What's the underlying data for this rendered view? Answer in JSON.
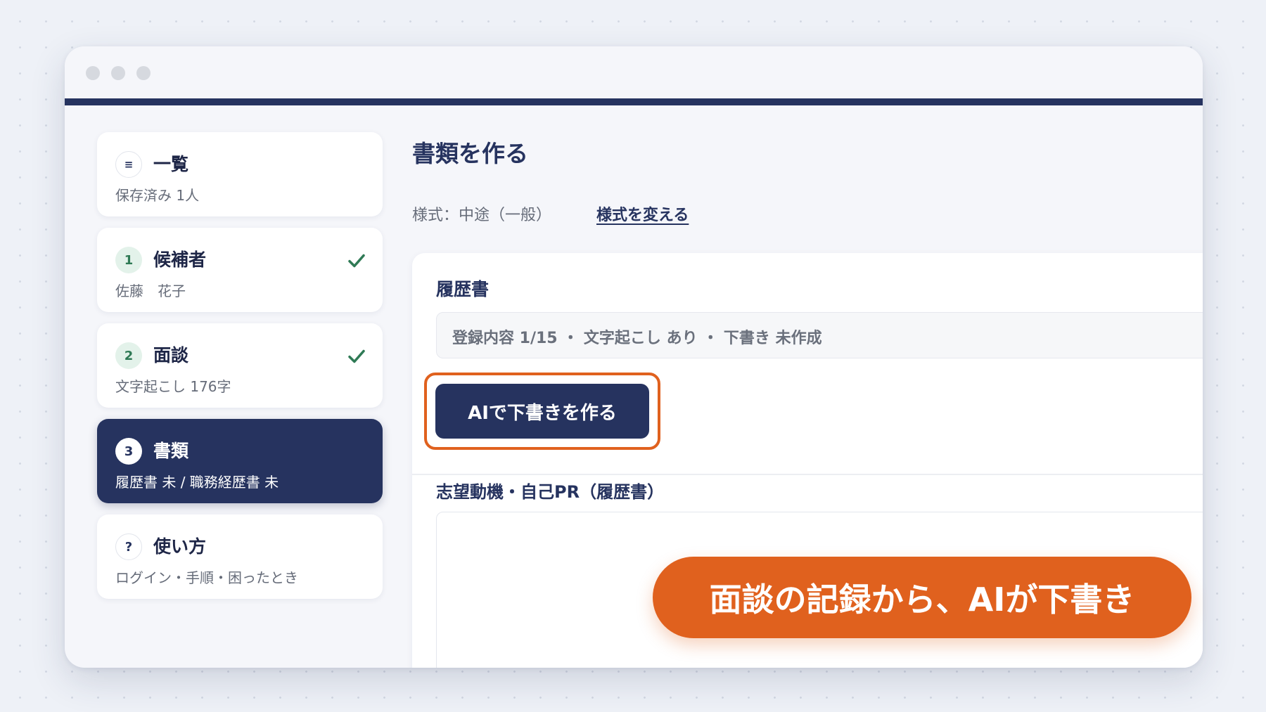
{
  "colors": {
    "navy": "#26335f",
    "orange": "#e0611e",
    "success_green": "#2f7a55"
  },
  "sidebar": {
    "items": [
      {
        "badge": "≡",
        "badge_icon": "list-icon",
        "title": "一覧",
        "sub": "保存済み 1人",
        "checked": false,
        "active": false
      },
      {
        "badge": "1",
        "title": "候補者",
        "sub": "佐藤　花子",
        "checked": true,
        "active": false
      },
      {
        "badge": "2",
        "title": "面談",
        "sub": "文字起こし 176字",
        "checked": true,
        "active": false
      },
      {
        "badge": "3",
        "title": "書類",
        "sub": "履歴書 未 / 職務経歴書 未",
        "checked": false,
        "active": true
      },
      {
        "badge": "?",
        "badge_icon": "help-icon",
        "title": "使い方",
        "sub": "ログイン・手順・困ったとき",
        "checked": false,
        "active": false
      }
    ]
  },
  "main": {
    "title": "書類を作る",
    "format_label": "様式：中途（一般）",
    "format_link": "様式を変える",
    "panel": {
      "title": "履歴書",
      "status": "登録内容 1/15 ・ 文字起こし あり ・ 下書き 未作成",
      "ai_button": "AIで下書きを作る",
      "field_label": "志望動機・自己PR（履歴書）",
      "field_value": ""
    }
  },
  "callout": "面談の記録から、AIが下書き"
}
